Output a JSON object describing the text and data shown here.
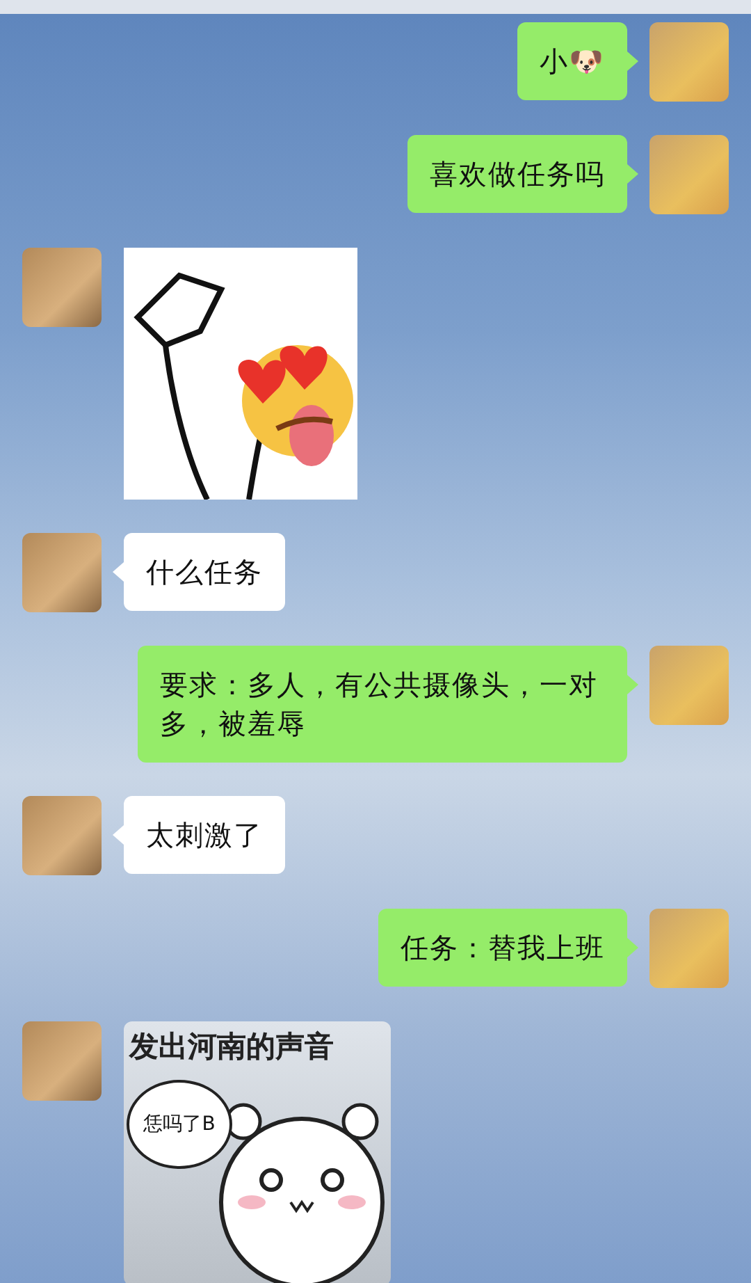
{
  "messages": [
    {
      "kind": "outgoing-text",
      "text": "小🐶"
    },
    {
      "kind": "outgoing-text",
      "text": "喜欢做任务吗"
    },
    {
      "kind": "incoming-sticker"
    },
    {
      "kind": "incoming-text",
      "text": "什么任务"
    },
    {
      "kind": "outgoing-text",
      "text": "要求：多人，有公共摄像头，一对多，被羞辱"
    },
    {
      "kind": "incoming-text",
      "text": "太刺激了"
    },
    {
      "kind": "outgoing-text",
      "text": "任务：替我上班"
    },
    {
      "kind": "incoming-meme",
      "caption": "发出河南的声音",
      "bubble": "恁吗了B"
    }
  ]
}
